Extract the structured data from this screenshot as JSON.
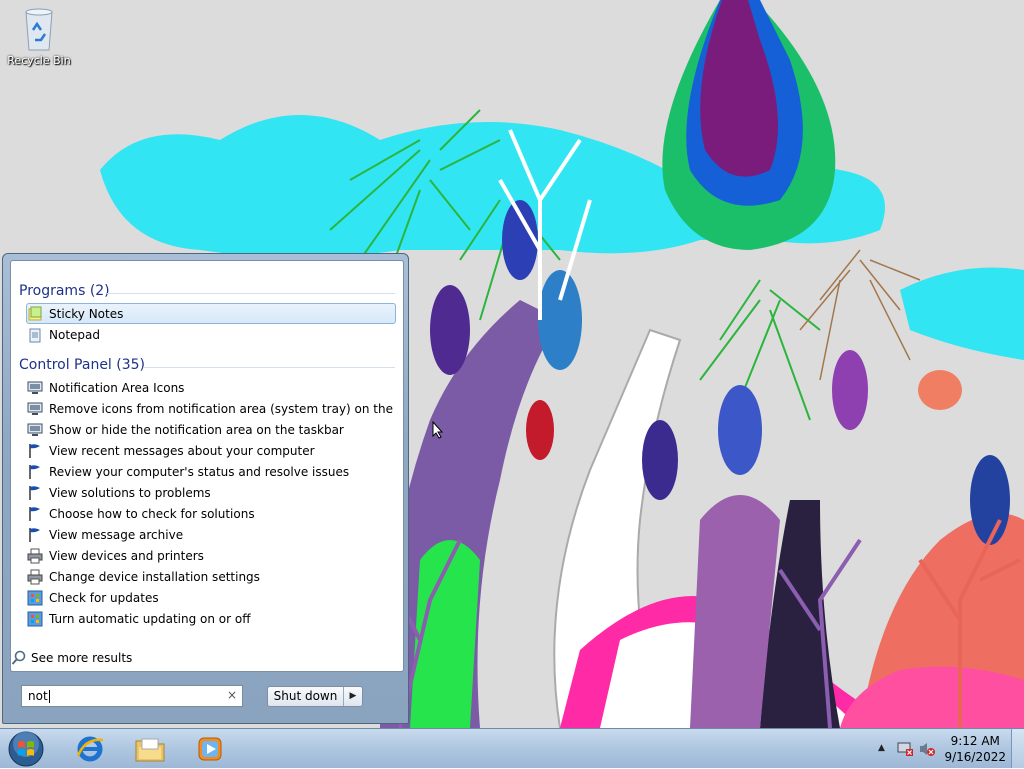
{
  "desktop": {
    "icons": [
      {
        "label": "Recycle Bin",
        "icon": "recycle-bin-icon"
      }
    ]
  },
  "start_menu": {
    "groups": [
      {
        "title": "Programs (2)",
        "items": [
          {
            "label": "Sticky Notes",
            "icon": "sticky-notes-icon",
            "selected": true
          },
          {
            "label": "Notepad",
            "icon": "notepad-icon"
          }
        ]
      },
      {
        "title": "Control Panel (35)",
        "items": [
          {
            "label": "Notification Area Icons",
            "icon": "monitor-icon"
          },
          {
            "label": "Remove icons from notification area (system tray) on the deskt...",
            "icon": "monitor-icon"
          },
          {
            "label": "Show or hide the notification area on the taskbar",
            "icon": "monitor-icon"
          },
          {
            "label": "View recent messages about your computer",
            "icon": "flag-icon"
          },
          {
            "label": "Review your computer's status and resolve issues",
            "icon": "flag-icon"
          },
          {
            "label": "View solutions to problems",
            "icon": "flag-icon"
          },
          {
            "label": "Choose how to check for solutions",
            "icon": "flag-icon"
          },
          {
            "label": "View message archive",
            "icon": "flag-icon"
          },
          {
            "label": "View devices and printers",
            "icon": "printer-icon"
          },
          {
            "label": "Change device installation settings",
            "icon": "printer-icon"
          },
          {
            "label": "Check for updates",
            "icon": "windows-update-icon"
          },
          {
            "label": "Turn automatic updating on or off",
            "icon": "windows-update-icon"
          }
        ]
      }
    ],
    "see_more": "See more results",
    "search": {
      "value": "not",
      "clear": "×"
    },
    "shutdown": {
      "label": "Shut down",
      "arrow": "▶"
    }
  },
  "taskbar": {
    "pinned": [
      {
        "name": "start-orb",
        "icon": "windows-logo-icon"
      },
      {
        "name": "internet-explorer",
        "icon": "internet-explorer-icon"
      },
      {
        "name": "windows-explorer",
        "icon": "folder-icon"
      },
      {
        "name": "media-player",
        "icon": "media-player-icon"
      }
    ],
    "tray": {
      "time": "9:12 AM",
      "date": "9/16/2022"
    }
  },
  "colors": {
    "taskbar_top": "#c9dbee",
    "taskbar_bottom": "#9db8d6",
    "group_header": "#1e3287",
    "selection_border": "#8eb4dc"
  }
}
